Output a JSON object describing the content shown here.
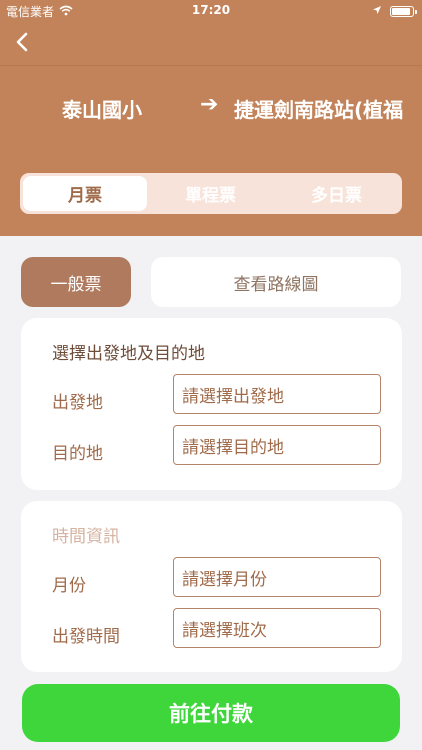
{
  "status": {
    "carrier": "電信業者",
    "time": "17:20",
    "battery_level": 0.9
  },
  "route": {
    "from": "泰山國小",
    "arrow": "➔",
    "to": "捷運劍南路站(植福"
  },
  "tabs": [
    {
      "label": "月票",
      "active": true
    },
    {
      "label": "單程票",
      "active": false
    },
    {
      "label": "多日票",
      "active": false
    }
  ],
  "chips": {
    "general": "一般票",
    "map": "查看路線圖"
  },
  "location_card": {
    "title": "選擇出發地及目的地",
    "origin_label": "出發地",
    "origin_placeholder": "請選擇出發地",
    "destination_label": "目的地",
    "destination_placeholder": "請選擇目的地"
  },
  "time_card": {
    "title": "時間資訊",
    "month_label": "月份",
    "month_placeholder": "請選擇月份",
    "departure_label": "出發時間",
    "departure_placeholder": "請選擇班次"
  },
  "pay_button": "前往付款",
  "colors": {
    "brand": "#c3835a",
    "accent": "#a06b4a",
    "pay": "#3fd63b"
  }
}
